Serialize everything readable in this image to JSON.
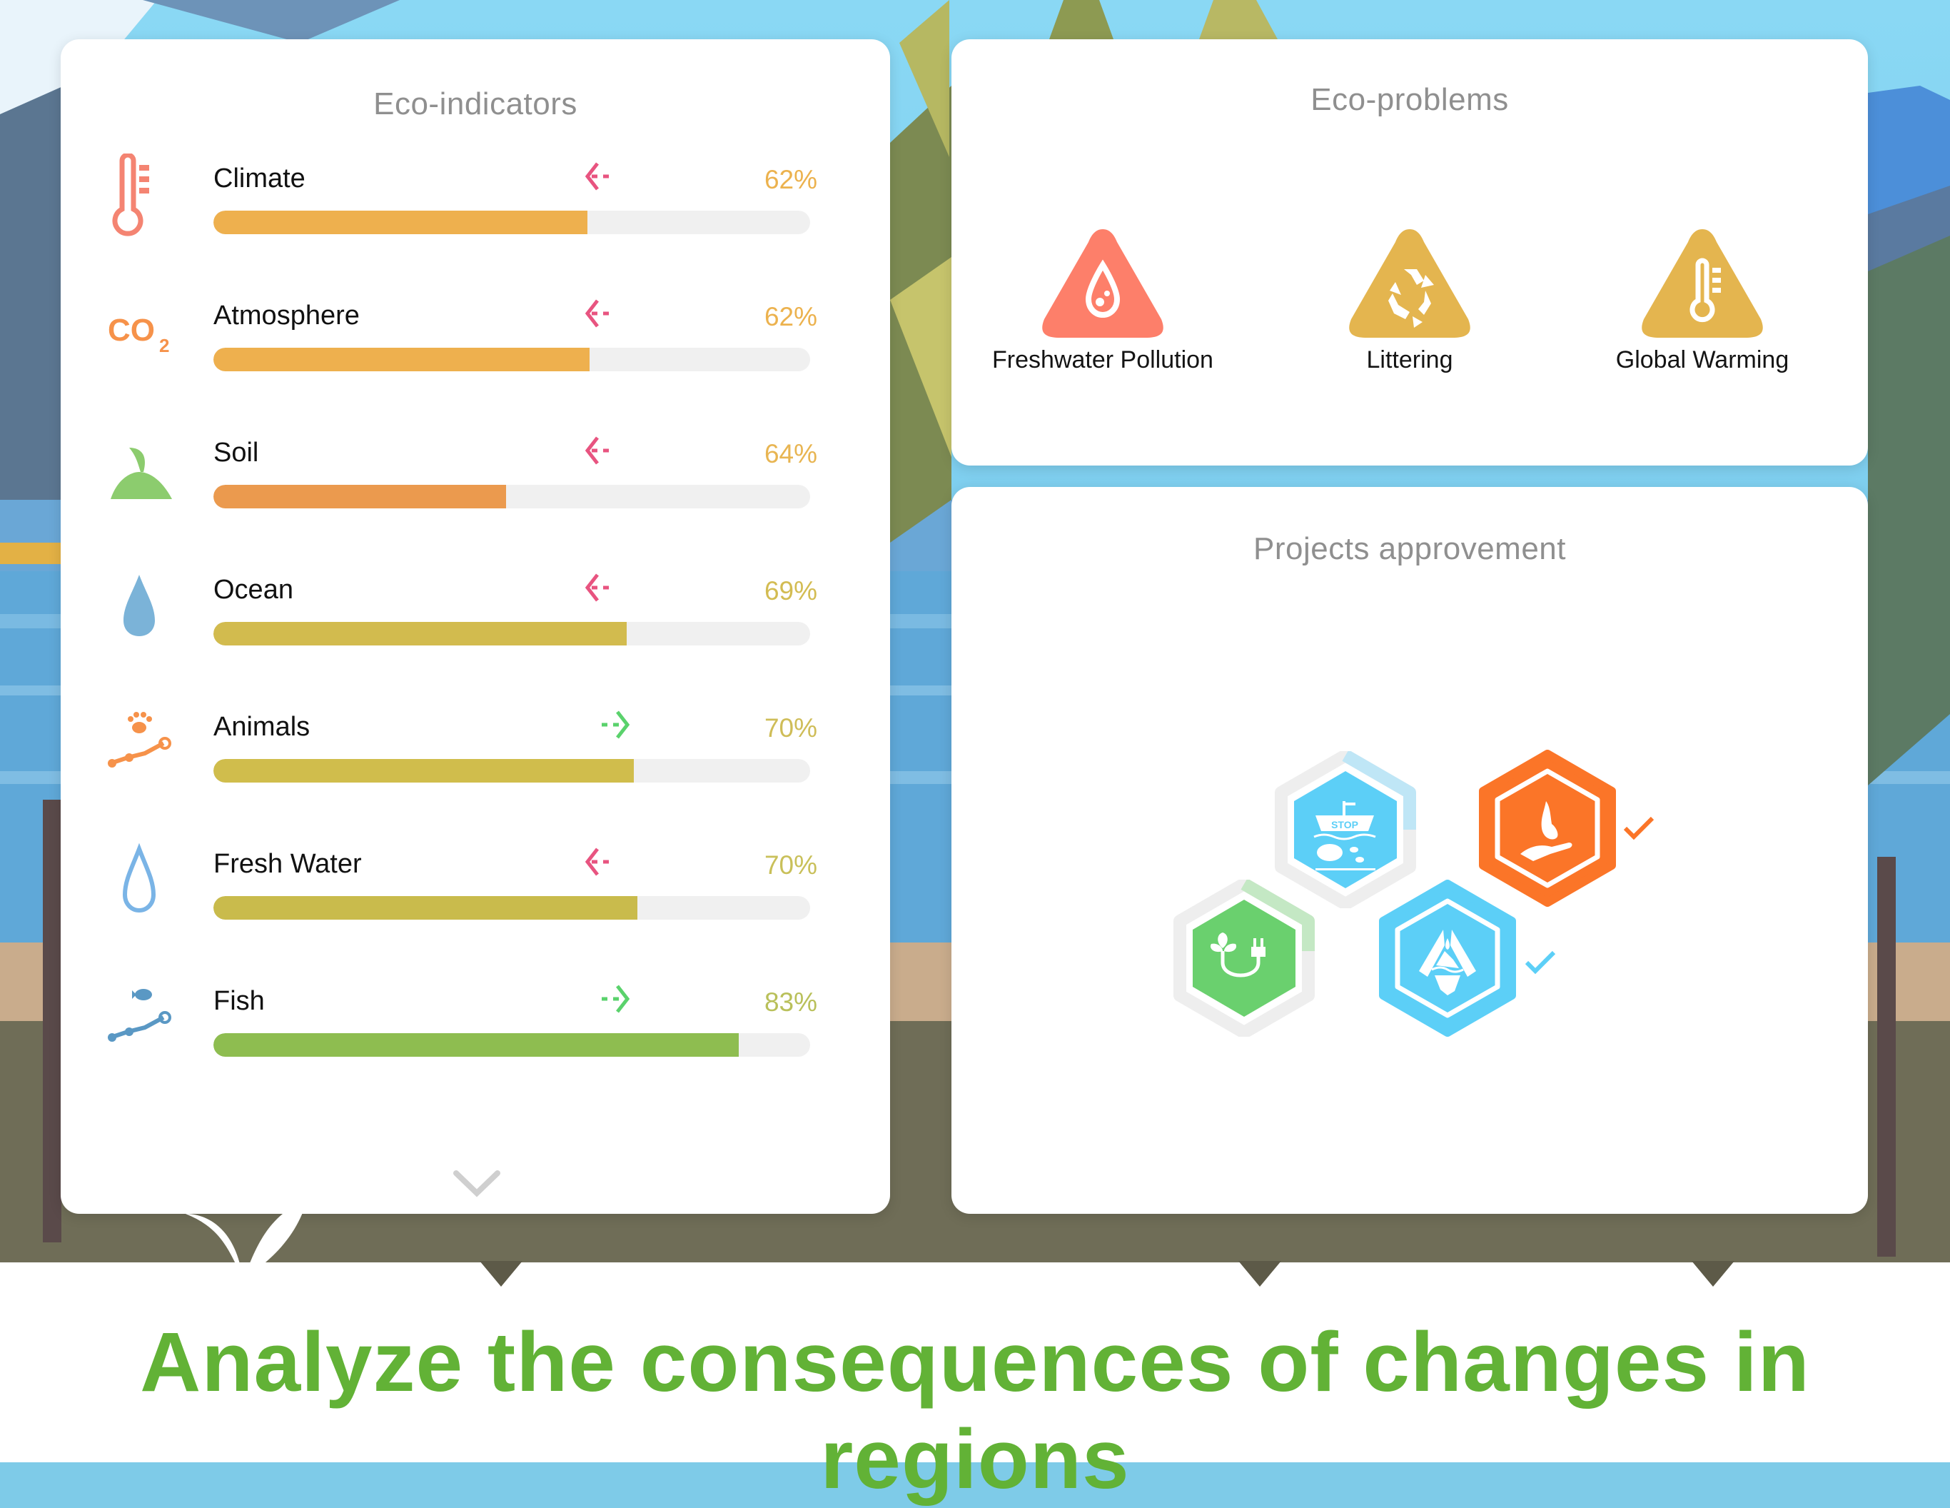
{
  "eco_indicators": {
    "title": "Eco-indicators",
    "items": [
      {
        "label": "Climate",
        "value_text": "62%",
        "bar_fill_fraction": 0.627,
        "trend": "down",
        "icon": "thermometer-icon",
        "bar_color": "#eeb04e",
        "value_color": "#ecb24e",
        "arrow_color": "#e85480",
        "icon_color": "#f48472"
      },
      {
        "label": "Atmosphere",
        "value_text": "62%",
        "bar_fill_fraction": 0.63,
        "trend": "down",
        "icon": "co2-icon",
        "icon_text": "CO",
        "icon_sub": "2",
        "bar_color": "#eeb04e",
        "value_color": "#ecb24e",
        "arrow_color": "#e85480",
        "icon_color": "#f6924a"
      },
      {
        "label": "Soil",
        "value_text": "64%",
        "bar_fill_fraction": 0.49,
        "trend": "down",
        "icon": "sprout-icon",
        "bar_color": "#eb9a4e",
        "value_color": "#e8b552",
        "arrow_color": "#e85480",
        "icon_color": "#8ccc6e"
      },
      {
        "label": "Ocean",
        "value_text": "69%",
        "bar_fill_fraction": 0.693,
        "trend": "down",
        "icon": "water-drop-icon",
        "bar_color": "#d2bb4e",
        "value_color": "#d3bc52",
        "arrow_color": "#e85480",
        "icon_color": "#7bb3d8"
      },
      {
        "label": "Animals",
        "value_text": "70%",
        "bar_fill_fraction": 0.705,
        "trend": "up",
        "icon": "paw-graph-icon",
        "bar_color": "#d0bd4c",
        "value_color": "#cfbd58",
        "arrow_color": "#5ad26c",
        "icon_color": "#f6924a"
      },
      {
        "label": "Fresh Water",
        "value_text": "70%",
        "bar_fill_fraction": 0.71,
        "trend": "down",
        "icon": "fresh-water-drop-icon",
        "bar_color": "#c9bb4c",
        "value_color": "#c9c05a",
        "arrow_color": "#e85480",
        "icon_color": "#7ab4e6"
      },
      {
        "label": "Fish",
        "value_text": "83%",
        "bar_fill_fraction": 0.88,
        "trend": "up",
        "icon": "fish-graph-icon",
        "bar_color": "#8ebd50",
        "value_color": "#b9c05a",
        "arrow_color": "#5ad26c",
        "icon_color": "#5a98c4"
      }
    ],
    "scroll_more": "chevron-down-icon"
  },
  "eco_problems": {
    "title": "Eco-problems",
    "items": [
      {
        "label": "Freshwater Pollution",
        "icon": "water-drop-warning-icon",
        "color": "#fd7f6a"
      },
      {
        "label": "Littering",
        "icon": "recycle-warning-icon",
        "color": "#e4b54f"
      },
      {
        "label": "Global Warming",
        "icon": "thermometer-warning-icon",
        "color": "#e4b54f"
      }
    ]
  },
  "projects": {
    "title": "Projects approvement",
    "items": [
      {
        "name": "stop-fishing-project",
        "icon": "stop-ship-fish-icon",
        "icon_text": "STOP",
        "color": "#5ccff7",
        "approved": false,
        "progress_fraction": 0.25
      },
      {
        "name": "animal-protection-project",
        "icon": "rabbit-hand-icon",
        "color": "#fb7528",
        "approved": true,
        "progress_fraction": 1.0
      },
      {
        "name": "green-energy-project",
        "icon": "leaf-plug-icon",
        "color": "#6ad06e",
        "approved": false,
        "progress_fraction": 0.22
      },
      {
        "name": "glacier-protection-project",
        "icon": "hands-iceberg-icon",
        "color": "#5ccff7",
        "approved": true,
        "progress_fraction": 1.0
      }
    ]
  },
  "banner": {
    "headline": "Analyze the consequences of changes in regions",
    "color": "#62b236"
  }
}
